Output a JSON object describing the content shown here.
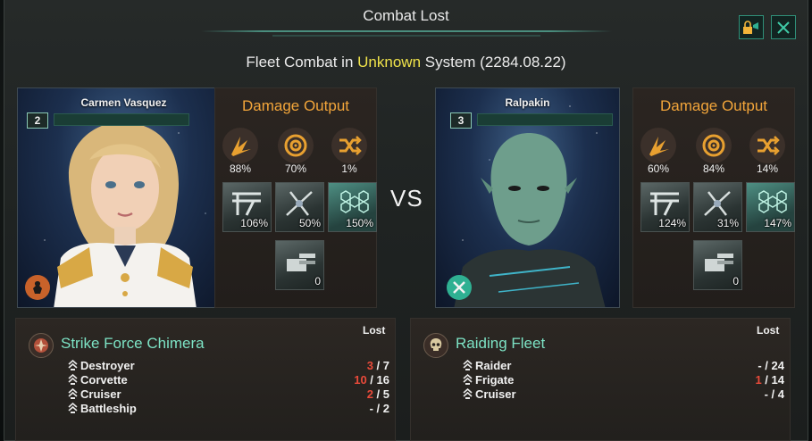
{
  "window": {
    "title": "Combat Lost",
    "subtitle_prefix": "Fleet Combat in ",
    "subtitle_highlight": "Unknown",
    "subtitle_suffix": " System (2284.08.22)",
    "vs_label": "VS",
    "colors": {
      "accent": "#2f8f78",
      "highlight": "#f0e34a",
      "damage_title": "#f2a53a",
      "fleet_name": "#7de3c5",
      "lost": "#e94a3a"
    }
  },
  "toolbar": {
    "camera_icon": "camera-lock-icon",
    "close_icon": "close-icon"
  },
  "left": {
    "leader": {
      "name": "Carmen Vasquez",
      "level": "2",
      "xp_fraction": 0.0,
      "trait_icon": "agent-trait-icon"
    },
    "damage": {
      "title": "Damage Output",
      "circles": [
        {
          "icon": "explosion-icon",
          "pct": "88%"
        },
        {
          "icon": "target-icon",
          "pct": "70%"
        },
        {
          "icon": "shuffle-icon",
          "pct": "1%"
        }
      ],
      "weapons": [
        {
          "icon": "kinetic-weapon-icon",
          "pct": "106%"
        },
        {
          "icon": "energy-weapon-icon",
          "pct": "50%"
        },
        {
          "icon": "hex-shield-icon",
          "pct": "150%"
        },
        {
          "icon": "turret-icon",
          "pct": "0"
        }
      ]
    },
    "fleet": {
      "name": "Strike Force Chimera",
      "lost_header": "Lost",
      "ships": [
        {
          "name": "Destroyer",
          "lost": "3",
          "total": "7"
        },
        {
          "name": "Corvette",
          "lost": "10",
          "total": "16"
        },
        {
          "name": "Cruiser",
          "lost": "2",
          "total": "5"
        },
        {
          "name": "Battleship",
          "lost": "-",
          "total": "2"
        }
      ]
    }
  },
  "right": {
    "leader": {
      "name": "Ralpakin",
      "level": "3",
      "xp_fraction": 0.0,
      "trait_icon": "crossed-swords-icon"
    },
    "damage": {
      "title": "Damage Output",
      "circles": [
        {
          "icon": "explosion-icon",
          "pct": "60%"
        },
        {
          "icon": "target-icon",
          "pct": "84%"
        },
        {
          "icon": "shuffle-icon",
          "pct": "14%"
        }
      ],
      "weapons": [
        {
          "icon": "kinetic-weapon-icon",
          "pct": "124%"
        },
        {
          "icon": "energy-weapon-icon",
          "pct": "31%"
        },
        {
          "icon": "hex-shield-icon",
          "pct": "147%"
        },
        {
          "icon": "turret-icon",
          "pct": "0"
        }
      ]
    },
    "fleet": {
      "name": "Raiding Fleet",
      "lost_header": "Lost",
      "ships": [
        {
          "name": "Raider",
          "lost": "-",
          "total": "24"
        },
        {
          "name": "Frigate",
          "lost": "1",
          "total": "14"
        },
        {
          "name": "Cruiser",
          "lost": "-",
          "total": "4"
        }
      ]
    }
  }
}
